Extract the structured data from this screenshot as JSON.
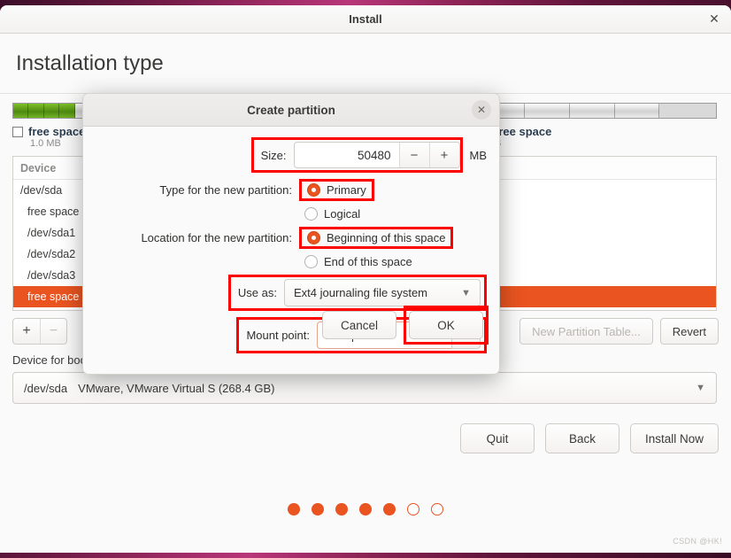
{
  "window": {
    "title": "Install",
    "close_icon": "close-icon",
    "page_title": "Installation type"
  },
  "partition_bar": {
    "segments": [
      {
        "kind": "green",
        "width_pct": 2.2
      },
      {
        "kind": "green",
        "width_pct": 2.2
      },
      {
        "kind": "green",
        "width_pct": 2.2
      },
      {
        "kind": "green",
        "width_pct": 2.2
      },
      {
        "kind": "grey",
        "width_pct": 6.4
      },
      {
        "kind": "grey",
        "width_pct": 6.4
      },
      {
        "kind": "grey",
        "width_pct": 6.4
      },
      {
        "kind": "grey",
        "width_pct": 6.4
      },
      {
        "kind": "grey",
        "width_pct": 6.4
      },
      {
        "kind": "grey",
        "width_pct": 6.4
      },
      {
        "kind": "grey",
        "width_pct": 6.4
      },
      {
        "kind": "grey",
        "width_pct": 6.4
      },
      {
        "kind": "grey",
        "width_pct": 6.4
      },
      {
        "kind": "grey",
        "width_pct": 6.4
      },
      {
        "kind": "grey",
        "width_pct": 6.4
      },
      {
        "kind": "grey",
        "width_pct": 6.4
      },
      {
        "kind": "grey",
        "width_pct": 6.4
      }
    ],
    "legend": [
      {
        "name": "free space",
        "size": "1.0 MB"
      },
      {
        "name": "free space",
        "size": "B"
      }
    ]
  },
  "device_table": {
    "header": "Device",
    "rows": [
      {
        "name": "/dev/sda",
        "indent": false,
        "selected": false
      },
      {
        "name": "free space",
        "indent": true,
        "selected": false
      },
      {
        "name": "/dev/sda1",
        "indent": true,
        "selected": false
      },
      {
        "name": "/dev/sda2",
        "indent": true,
        "selected": false
      },
      {
        "name": "/dev/sda3",
        "indent": true,
        "selected": false
      },
      {
        "name": "free space",
        "indent": true,
        "selected": true
      }
    ]
  },
  "toolbar": {
    "add_label": "+",
    "remove_label": "−",
    "new_partition_table_label": "New Partition Table...",
    "revert_label": "Revert"
  },
  "boot": {
    "label": "Device for boot loader installation:",
    "device": "/dev/sda",
    "description": "VMware, VMware Virtual S (268.4 GB)",
    "arrow_icon": "chevron-down-icon"
  },
  "nav": {
    "quit_label": "Quit",
    "back_label": "Back",
    "install_label": "Install Now"
  },
  "progress_dots": {
    "total": 7,
    "filled": 5,
    "filled_color": "#e95420"
  },
  "watermark": "CSDN @HK!",
  "dialog": {
    "title": "Create partition",
    "close_icon": "close-icon",
    "size": {
      "label": "Size:",
      "value": "50480",
      "unit": "MB",
      "minus_label": "−",
      "plus_label": "+"
    },
    "type": {
      "label": "Type for the new partition:",
      "options": [
        {
          "label": "Primary",
          "selected": true
        },
        {
          "label": "Logical",
          "selected": false
        }
      ]
    },
    "location": {
      "label": "Location for the new partition:",
      "options": [
        {
          "label": "Beginning of this space",
          "selected": true
        },
        {
          "label": "End of this space",
          "selected": false
        }
      ]
    },
    "use_as": {
      "label": "Use as:",
      "value": "Ext4 journaling file system",
      "arrow_icon": "chevron-down-icon"
    },
    "mount_point": {
      "label": "Mount point:",
      "value": "/data",
      "arrow_icon": "chevron-down-icon"
    },
    "cancel_label": "Cancel",
    "ok_label": "OK"
  },
  "annotation_color": "#fd0000"
}
